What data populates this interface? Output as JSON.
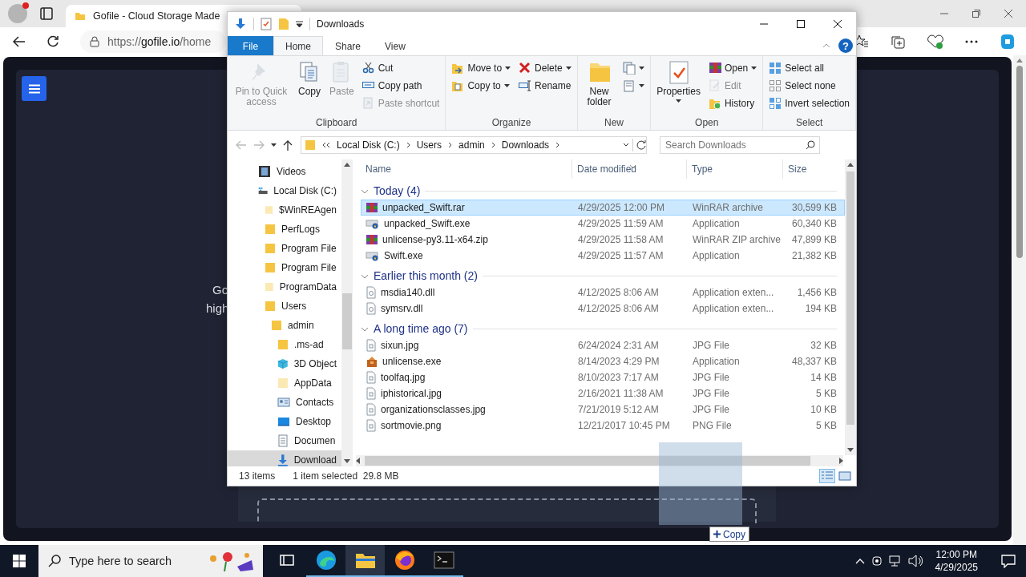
{
  "browser": {
    "tab": {
      "title": "Gofile - Cloud Storage Made"
    },
    "url": "https://**gofile.io**/home",
    "page": {
      "hero_lines": [
        "Go",
        "high"
      ],
      "drag_tooltip": "Copy"
    }
  },
  "explorer": {
    "title": "Downloads",
    "tabs": [
      {
        "label": "File",
        "kind": "menu",
        "selected": false
      },
      {
        "label": "Home",
        "kind": "tab",
        "selected": true
      },
      {
        "label": "Share",
        "kind": "tab",
        "selected": false
      },
      {
        "label": "View",
        "kind": "tab",
        "selected": false
      }
    ],
    "help": "?",
    "ribbon": [
      {
        "label": "Clipboard",
        "columns": [
          {
            "kind": "large",
            "label": "Pin to Quick access",
            "disabled": true,
            "menu": false
          },
          {
            "kind": "large",
            "label": "Copy",
            "disabled": false,
            "menu": false
          },
          {
            "kind": "large",
            "label": "Paste",
            "disabled": true,
            "menu": false
          },
          {
            "kind": "stack",
            "items": [
              {
                "label": "Cut",
                "disabled": false,
                "menu": false
              },
              {
                "label": "Copy path",
                "disabled": false,
                "menu": false
              },
              {
                "label": "Paste shortcut",
                "disabled": true,
                "menu": false
              }
            ]
          }
        ]
      },
      {
        "label": "Organize",
        "columns": [
          {
            "kind": "stack",
            "items": [
              {
                "label": "Move to",
                "disabled": false,
                "menu": true
              },
              {
                "label": "Copy to",
                "disabled": false,
                "menu": true
              }
            ]
          },
          {
            "kind": "stack",
            "items": [
              {
                "label": "Delete",
                "disabled": false,
                "menu": true
              },
              {
                "label": "Rename",
                "disabled": false,
                "menu": false
              }
            ]
          }
        ]
      },
      {
        "label": "New",
        "columns": [
          {
            "kind": "large",
            "label": "New folder",
            "disabled": false,
            "menu": false
          },
          {
            "kind": "stack",
            "items": [
              {
                "disabled": false,
                "menu": true
              },
              {
                "disabled": false,
                "menu": true
              }
            ]
          }
        ]
      },
      {
        "label": "Open",
        "columns": [
          {
            "kind": "large",
            "label": "Properties",
            "disabled": false,
            "menu": true
          },
          {
            "kind": "stack",
            "items": [
              {
                "label": "Open",
                "disabled": false,
                "menu": true
              },
              {
                "label": "Edit",
                "disabled": true,
                "menu": false
              },
              {
                "label": "History",
                "disabled": false,
                "menu": false
              }
            ]
          }
        ]
      },
      {
        "label": "Select",
        "columns": [
          {
            "kind": "stack",
            "items": [
              {
                "label": "Select all",
                "disabled": false,
                "menu": false
              },
              {
                "label": "Select none",
                "disabled": false,
                "menu": false
              },
              {
                "label": "Invert selection",
                "disabled": false,
                "menu": false
              }
            ]
          }
        ]
      }
    ],
    "address": {
      "crumbs": [
        "Local Disk (C:)",
        "Users",
        "admin",
        "Downloads"
      ]
    },
    "search": {
      "placeholder": "Search Downloads"
    },
    "nav": [
      {
        "label": "Videos",
        "kind": "videos",
        "selected": false
      },
      {
        "label": "Local Disk (C:)",
        "kind": "drive",
        "selected": false,
        "children": [
          {
            "label": "$WinREAgen",
            "kind": "hidden-folder",
            "selected": false
          },
          {
            "label": "PerfLogs",
            "kind": "folder",
            "selected": false
          },
          {
            "label": "Program File",
            "kind": "folder",
            "selected": false
          },
          {
            "label": "Program File",
            "kind": "folder",
            "selected": false
          },
          {
            "label": "ProgramData",
            "kind": "hidden-folder",
            "selected": false
          },
          {
            "label": "Users",
            "kind": "folder",
            "selected": false,
            "children": [
              {
                "label": "admin",
                "kind": "folder",
                "selected": false,
                "children": [
                  {
                    "label": ".ms-ad",
                    "kind": "folder",
                    "selected": false
                  },
                  {
                    "label": "3D Object",
                    "kind": "cube",
                    "selected": false
                  },
                  {
                    "label": "AppData",
                    "kind": "hidden-folder",
                    "selected": false
                  },
                  {
                    "label": "Contacts",
                    "kind": "contacts",
                    "selected": false
                  },
                  {
                    "label": "Desktop",
                    "kind": "desktop",
                    "selected": false
                  },
                  {
                    "label": "Documen",
                    "kind": "documents",
                    "selected": false
                  },
                  {
                    "label": "Download",
                    "kind": "downloads",
                    "selected": true
                  }
                ]
              }
            ]
          }
        ]
      }
    ],
    "columns": [
      "Name",
      "Date modified",
      "Type",
      "Size"
    ],
    "groups": [
      {
        "label": "Today (4)",
        "expanded": true,
        "files": [
          {
            "name": "unpacked_Swift.rar",
            "date": "4/29/2025 12:00 PM",
            "type": "WinRAR archive",
            "size": "30,599 KB",
            "kind": "archive",
            "selected": true
          },
          {
            "name": "unpacked_Swift.exe",
            "date": "4/29/2025 11:59 AM",
            "type": "Application",
            "size": "60,340 KB",
            "kind": "application",
            "selected": false
          },
          {
            "name": "unlicense-py3.11-x64.zip",
            "date": "4/29/2025 11:58 AM",
            "type": "WinRAR ZIP archive",
            "size": "47,899 KB",
            "kind": "archive",
            "selected": false
          },
          {
            "name": "Swift.exe",
            "date": "4/29/2025 11:57 AM",
            "type": "Application",
            "size": "21,382 KB",
            "kind": "application",
            "selected": false
          }
        ]
      },
      {
        "label": "Earlier this month (2)",
        "expanded": true,
        "files": [
          {
            "name": "msdia140.dll",
            "date": "4/12/2025 8:06 AM",
            "type": "Application exten...",
            "size": "1,456 KB",
            "kind": "library",
            "selected": false
          },
          {
            "name": "symsrv.dll",
            "date": "4/12/2025 8:06 AM",
            "type": "Application exten...",
            "size": "194 KB",
            "kind": "library",
            "selected": false
          }
        ]
      },
      {
        "label": "A long time ago (7)",
        "expanded": true,
        "files": [
          {
            "name": "sixun.jpg",
            "date": "6/24/2024 2:31 AM",
            "type": "JPG File",
            "size": "32 KB",
            "kind": "image",
            "selected": false
          },
          {
            "name": "unlicense.exe",
            "date": "8/14/2023 4:29 PM",
            "type": "Application",
            "size": "48,337 KB",
            "kind": "package",
            "selected": false
          },
          {
            "name": "toolfaq.jpg",
            "date": "8/10/2023 7:17 AM",
            "type": "JPG File",
            "size": "14 KB",
            "kind": "image",
            "selected": false
          },
          {
            "name": "iphistorical.jpg",
            "date": "2/16/2021 11:38 AM",
            "type": "JPG File",
            "size": "5 KB",
            "kind": "image",
            "selected": false
          },
          {
            "name": "organizationsclasses.jpg",
            "date": "7/21/2019 5:12 AM",
            "type": "JPG File",
            "size": "10 KB",
            "kind": "image",
            "selected": false
          },
          {
            "name": "sortmovie.png",
            "date": "12/21/2017 10:45 PM",
            "type": "PNG File",
            "size": "5 KB",
            "kind": "image",
            "selected": false
          }
        ]
      }
    ],
    "status": {
      "count": "13 items",
      "selection": "1 item selected",
      "size": "29.8 MB"
    },
    "views": [
      {
        "selected": true
      },
      {
        "selected": false
      }
    ]
  },
  "taskbar": {
    "search_placeholder": "Type here to search",
    "apps": [
      {
        "running": false,
        "selected": false
      },
      {
        "running": true,
        "selected": false
      },
      {
        "running": true,
        "selected": true
      },
      {
        "running": true,
        "selected": false
      },
      {
        "running": true,
        "selected": false
      }
    ],
    "clock": {
      "time": "12:00 PM",
      "date": "4/29/2025"
    }
  }
}
